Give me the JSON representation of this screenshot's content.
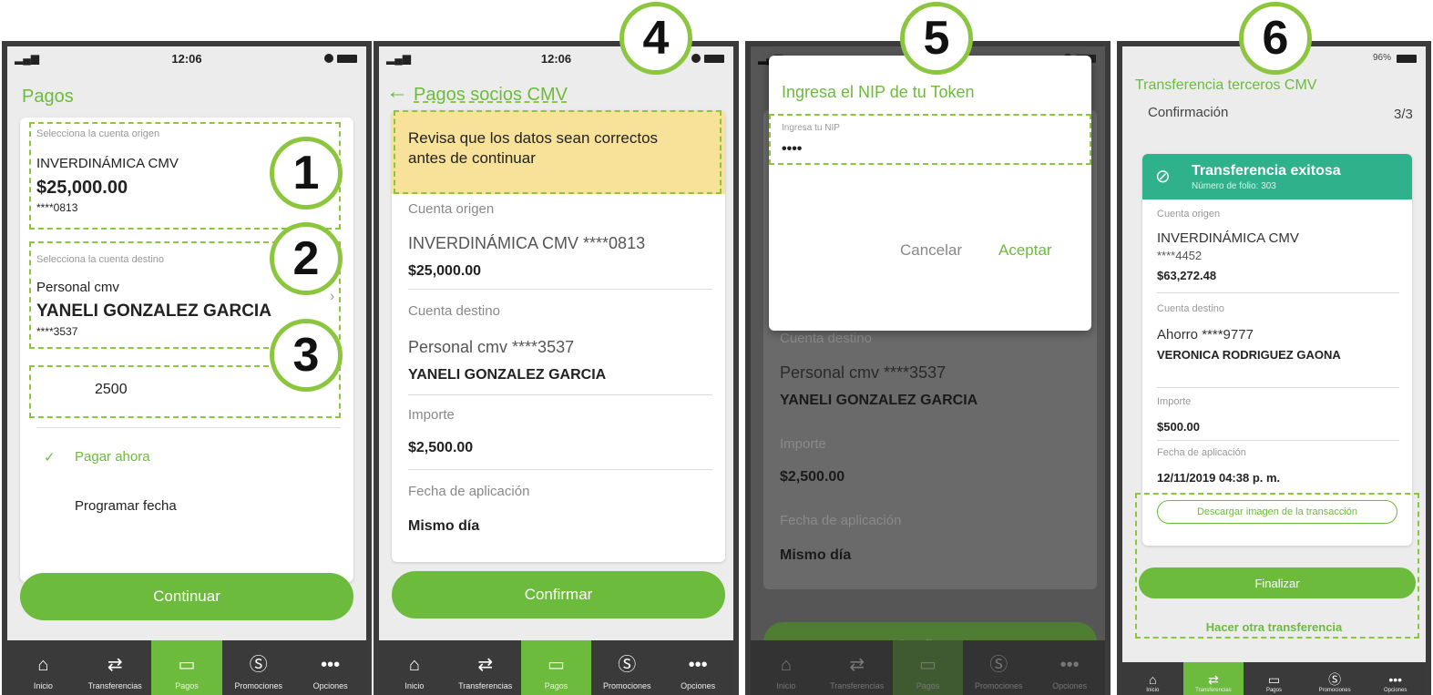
{
  "colors": {
    "accent": "#6cbb3c",
    "success": "#2fb28c",
    "tabbar": "#3a3a3a",
    "dashed": "#8cc63f"
  },
  "badges": [
    "1",
    "2",
    "3",
    "4",
    "5",
    "6"
  ],
  "tabs": [
    {
      "label": "Inicio",
      "icon": "home-icon"
    },
    {
      "label": "Transferencias",
      "icon": "transfer-icon"
    },
    {
      "label": "Pagos",
      "icon": "card-icon"
    },
    {
      "label": "Promociones",
      "icon": "dollar-coin-icon"
    },
    {
      "label": "Opciones",
      "icon": "more-icon"
    }
  ],
  "screen1": {
    "time": "12:06",
    "title": "Pagos",
    "origin_label": "Selecciona la cuenta origen",
    "origin_name": "INVERDINÁMICA CMV",
    "origin_amount": "$25,000.00",
    "origin_number": "****0813",
    "dest_label": "Selecciona la cuenta destino",
    "dest_type": "Personal cmv",
    "dest_name": "YANELI GONZALEZ GARCIA",
    "dest_number": "****3537",
    "amount_value": "2500",
    "pay_now": "Pagar ahora",
    "schedule": "Programar fecha",
    "continue_btn": "Continuar"
  },
  "screen2": {
    "time": "12:06",
    "title": "Pagos socios CMV",
    "notice": "Revisa que los datos sean correctos antes de continuar",
    "origin_label": "Cuenta origen",
    "origin_value": "INVERDINÁMICA CMV ****0813",
    "origin_amount": "$25,000.00",
    "dest_label": "Cuenta destino",
    "dest_value": "Personal cmv ****3537",
    "dest_name": "YANELI GONZALEZ GARCIA",
    "amount_label": "Importe",
    "amount_value": "$2,500.00",
    "date_label": "Fecha de aplicación",
    "date_value": "Mismo día",
    "confirm_btn": "Confirmar"
  },
  "screen3": {
    "dialog_title": "Ingresa el NIP de tu Token",
    "nip_label": "Ingresa tu NIP",
    "nip_value": "••••",
    "cancel": "Cancelar",
    "accept": "Aceptar",
    "dest_label": "Cuenta destino",
    "dest_value": "Personal cmv ****3537",
    "dest_name": "YANELI GONZALEZ GARCIA",
    "amount_label": "Importe",
    "amount_value": "$2,500.00",
    "date_label": "Fecha de aplicación",
    "date_value": "Mismo día",
    "confirm_btn": "Confirmar"
  },
  "screen4": {
    "battery": "96%",
    "title": "Transferencia terceros CMV",
    "subtitle": "Confirmación",
    "step": "3/3",
    "success_title": "Transferencia exitosa",
    "folio": "Número de folio: 303",
    "origin_label": "Cuenta origen",
    "origin_name": "INVERDINÁMICA CMV",
    "origin_number": "****4452",
    "origin_amount": "$63,272.48",
    "dest_label": "Cuenta destino",
    "dest_value": "Ahorro ****9777",
    "dest_name": "VERONICA RODRIGUEZ GAONA",
    "amount_label": "Importe",
    "amount_value": "$500.00",
    "date_label": "Fecha de aplicación",
    "date_value": "12/11/2019 04:38 p. m.",
    "download_btn": "Descargar imagen de la transacción",
    "finish_btn": "Finalizar",
    "another_link": "Hacer otra transferencia"
  }
}
